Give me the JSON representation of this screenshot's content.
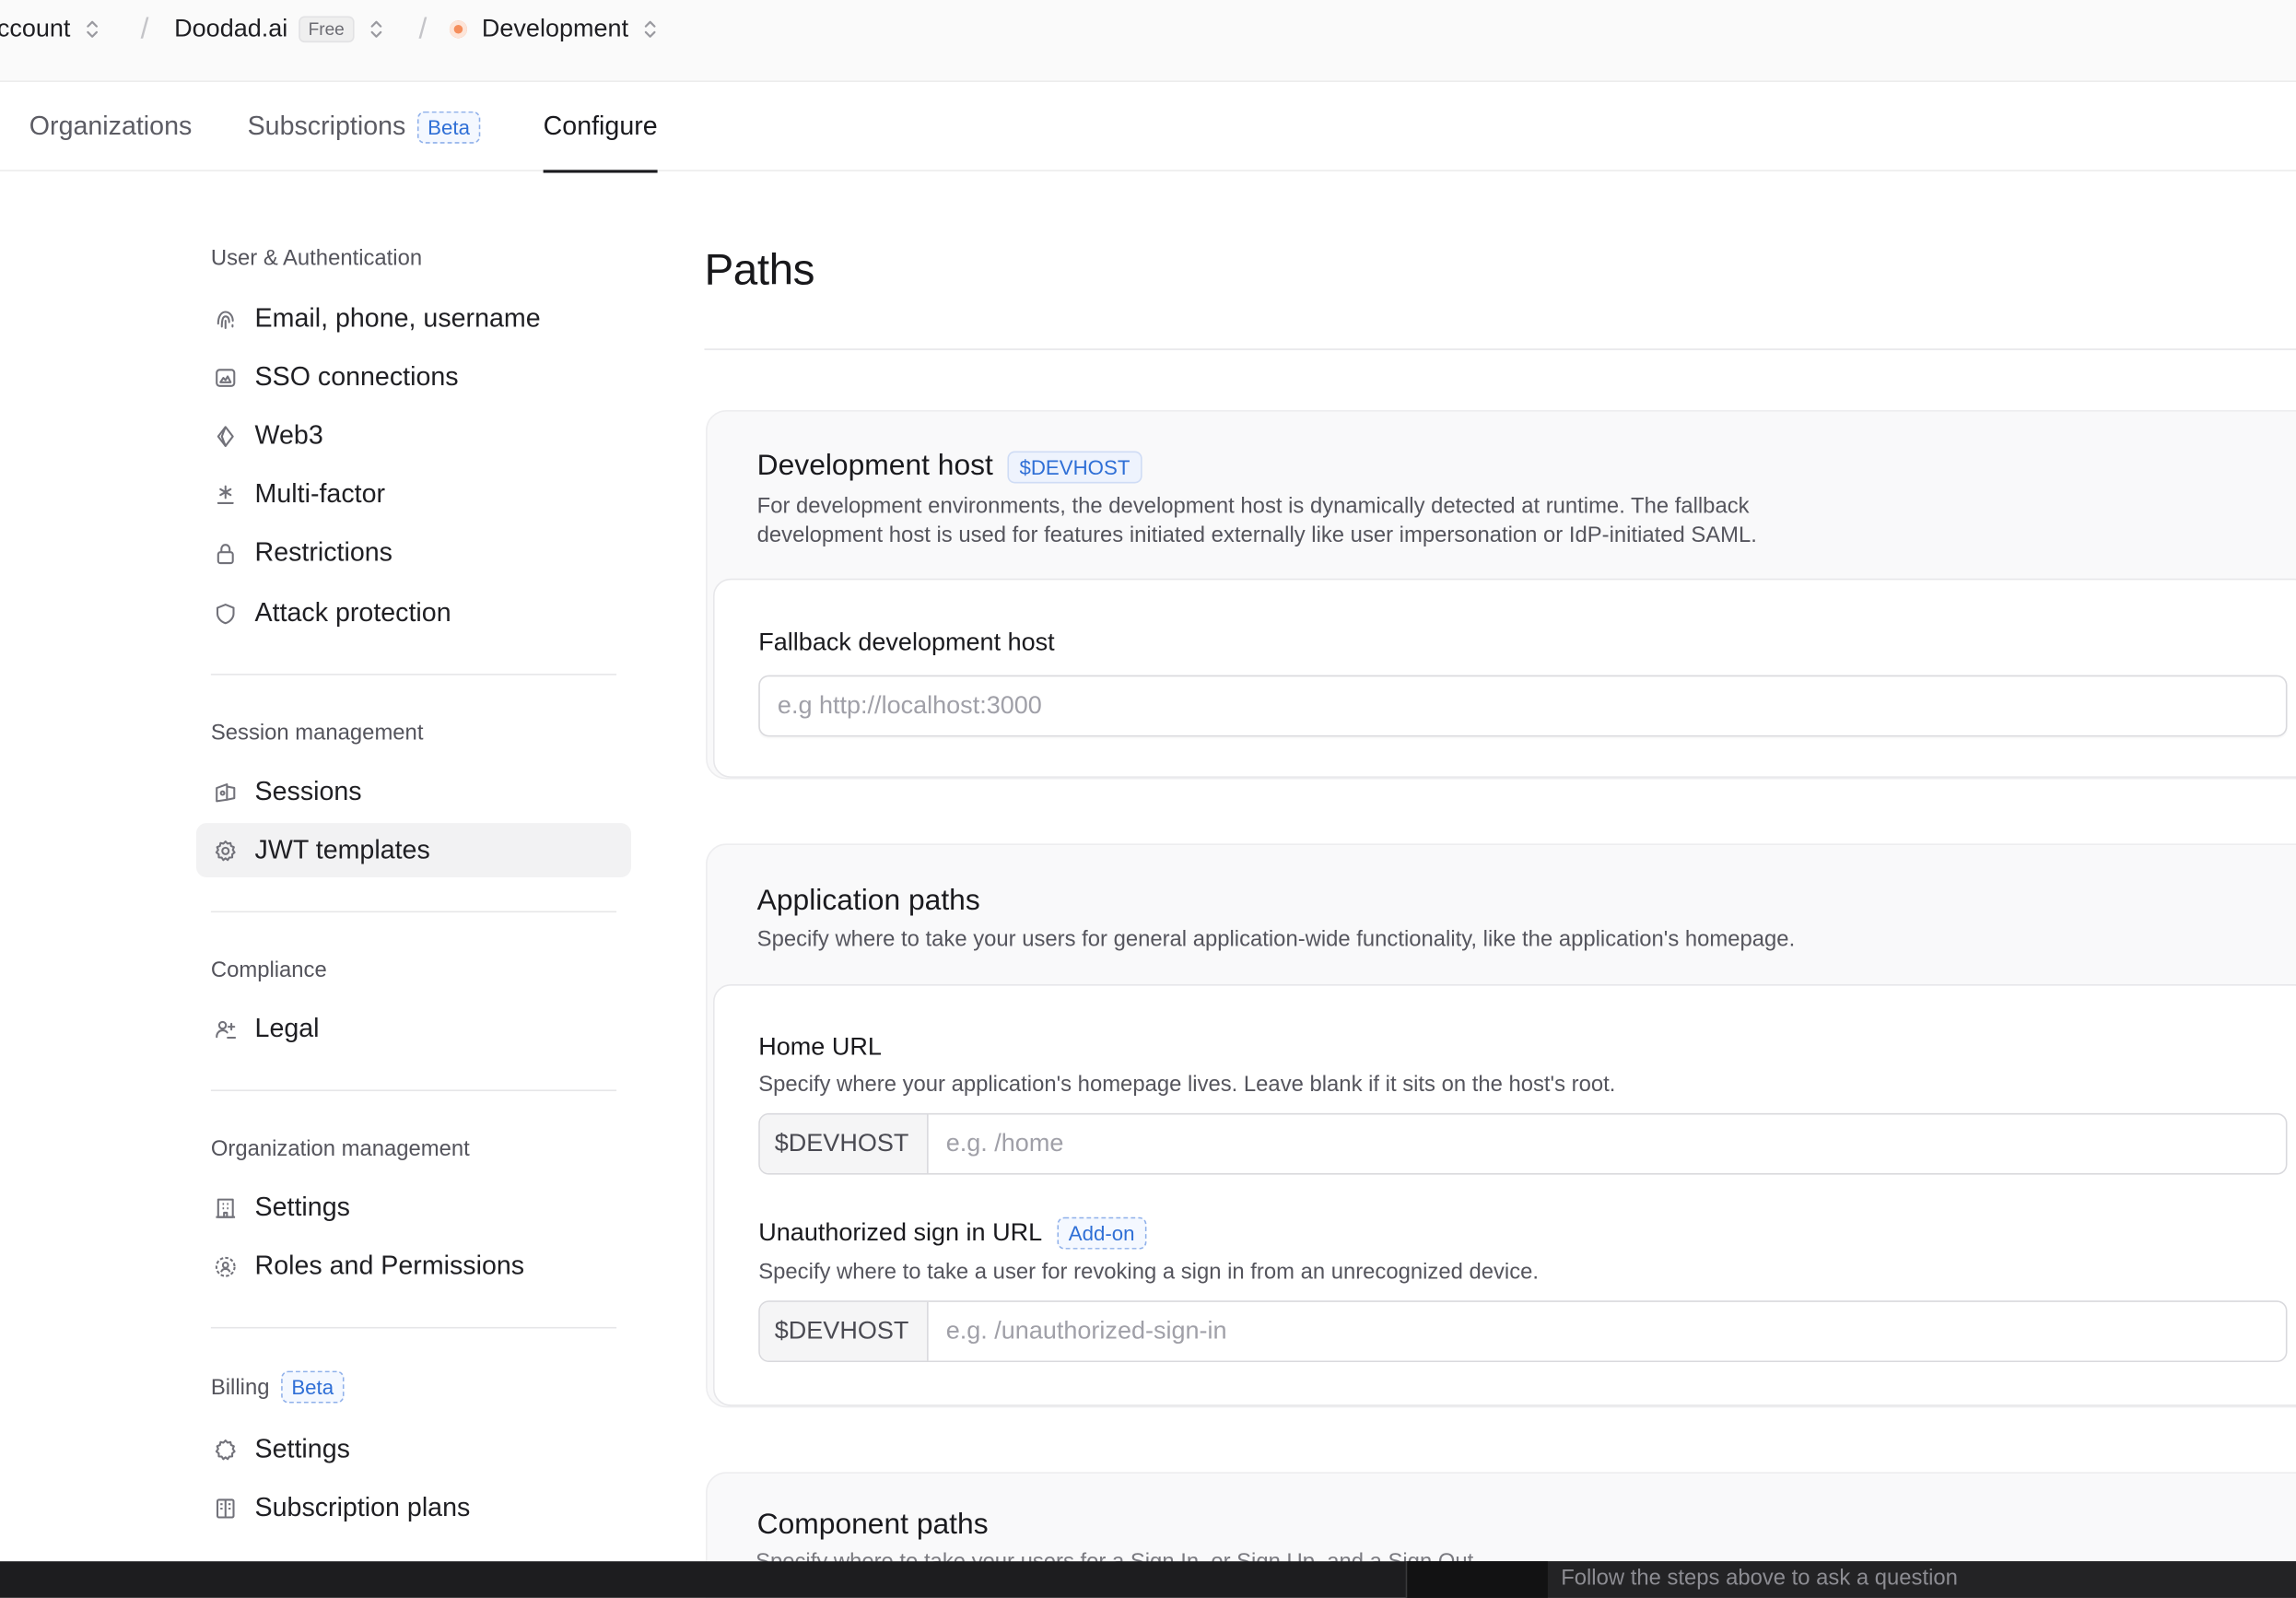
{
  "topbar": {
    "account_label": "ccount",
    "app_name": "Doodad.ai",
    "plan_badge": "Free",
    "environment_label": "Development"
  },
  "tabs": [
    {
      "label": "Organizations"
    },
    {
      "label": "Subscriptions",
      "badge": "Beta"
    },
    {
      "label": "Configure",
      "active": true
    }
  ],
  "sidebar": {
    "sections": [
      {
        "title": "User & Authentication",
        "items": [
          {
            "label": "Email, phone, username",
            "icon": "fingerprint-icon"
          },
          {
            "label": "SSO connections",
            "icon": "sso-icon"
          },
          {
            "label": "Web3",
            "icon": "web3-icon"
          },
          {
            "label": "Multi-factor",
            "icon": "asterisk-icon"
          },
          {
            "label": "Restrictions",
            "icon": "lock-icon"
          },
          {
            "label": "Attack protection",
            "icon": "shield-icon"
          }
        ]
      },
      {
        "title": "Session management",
        "items": [
          {
            "label": "Sessions",
            "icon": "sessions-icon"
          },
          {
            "label": "JWT templates",
            "icon": "gear-icon",
            "active": true
          }
        ]
      },
      {
        "title": "Compliance",
        "items": [
          {
            "label": "Legal",
            "icon": "legal-icon"
          }
        ]
      },
      {
        "title": "Organization management",
        "items": [
          {
            "label": "Settings",
            "icon": "building-icon"
          },
          {
            "label": "Roles and Permissions",
            "icon": "roles-icon"
          }
        ]
      },
      {
        "title": "Billing",
        "badge": "Beta",
        "items": [
          {
            "label": "Settings",
            "icon": "gear-icon"
          },
          {
            "label": "Subscription plans",
            "icon": "plans-icon"
          }
        ]
      }
    ]
  },
  "main": {
    "title": "Paths",
    "dev_host": {
      "title": "Development host",
      "badge": "$DEVHOST",
      "description_line1": "For development environments, the development host is dynamically detected at runtime. The fallback",
      "description_line2": "development host is used for features initiated externally like user impersonation or IdP-initiated SAML.",
      "fallback_label": "Fallback development host",
      "fallback_value": "",
      "fallback_placeholder": "e.g http://localhost:3000"
    },
    "app_paths": {
      "title": "Application paths",
      "description": "Specify where to take your users for general application-wide functionality, like the application's homepage.",
      "home_label": "Home URL",
      "home_help": "Specify where your application's homepage lives. Leave blank if it sits on the host's root.",
      "home_prefix": "$DEVHOST",
      "home_value": "",
      "home_placeholder": "e.g. /home",
      "unauth_label": "Unauthorized sign in URL",
      "unauth_badge": "Add-on",
      "unauth_help": "Specify where to take a user for revoking a sign in from an unrecognized device.",
      "unauth_prefix": "$DEVHOST",
      "unauth_value": "",
      "unauth_placeholder": "e.g. /unauthorized-sign-in"
    },
    "component_paths": {
      "title": "Component paths",
      "description_partial": "Specify where to take your users for a Sign In, or Sign Up, and a Sign Out"
    }
  },
  "bottom_bar": {
    "prompt": "Follow the steps above to ask a question"
  },
  "colors": {
    "accent_blue": "#2f6fd6",
    "env_dot": "#f58e5c",
    "text_primary": "#1a1a1e",
    "text_secondary": "#55555d"
  }
}
